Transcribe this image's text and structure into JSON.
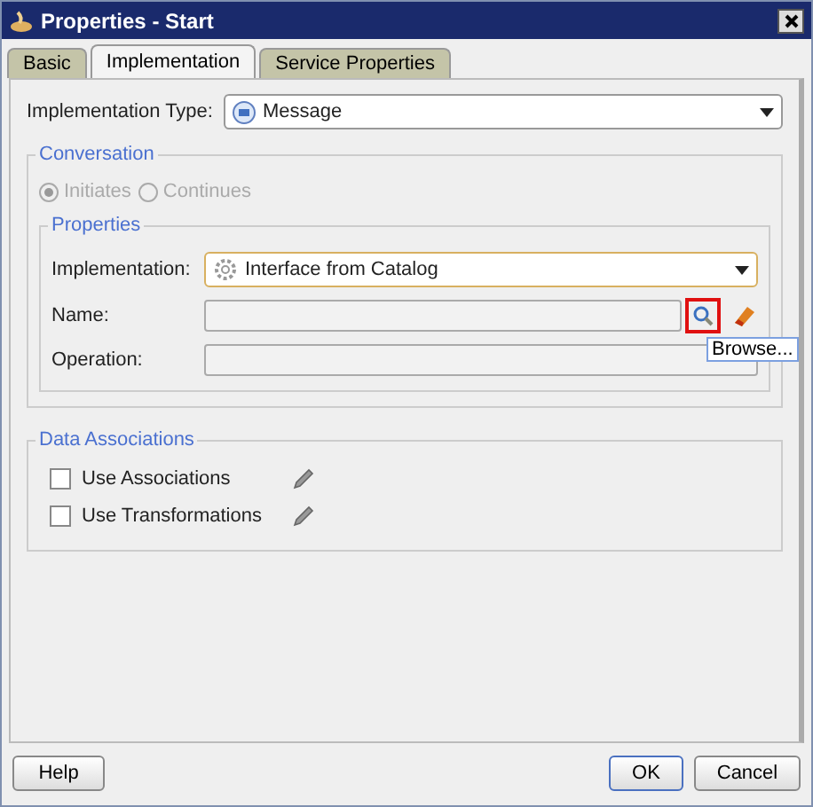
{
  "window": {
    "title": "Properties - Start"
  },
  "tabs": [
    {
      "label": "Basic",
      "selected": false
    },
    {
      "label": "Implementation",
      "selected": true
    },
    {
      "label": "Service Properties",
      "selected": false
    }
  ],
  "implementation_type": {
    "label": "Implementation Type:",
    "value": "Message"
  },
  "conversation": {
    "title": "Conversation",
    "disabled": true,
    "options": [
      {
        "label": "Initiates",
        "selected": true
      },
      {
        "label": "Continues",
        "selected": false
      }
    ]
  },
  "properties": {
    "title": "Properties",
    "implementation": {
      "label": "Implementation:",
      "value": "Interface from Catalog"
    },
    "name": {
      "label": "Name:"
    },
    "operation": {
      "label": "Operation:"
    },
    "browse_highlighted": true,
    "tooltip": "Browse..."
  },
  "data_associations": {
    "title": "Data Associations",
    "options": [
      {
        "label": "Use Associations",
        "checked": false
      },
      {
        "label": "Use Transformations",
        "checked": false
      }
    ]
  },
  "buttons": [
    {
      "label": "Help",
      "default": false
    },
    {
      "label": "OK",
      "default": true
    },
    {
      "label": "Cancel",
      "default": false
    }
  ]
}
